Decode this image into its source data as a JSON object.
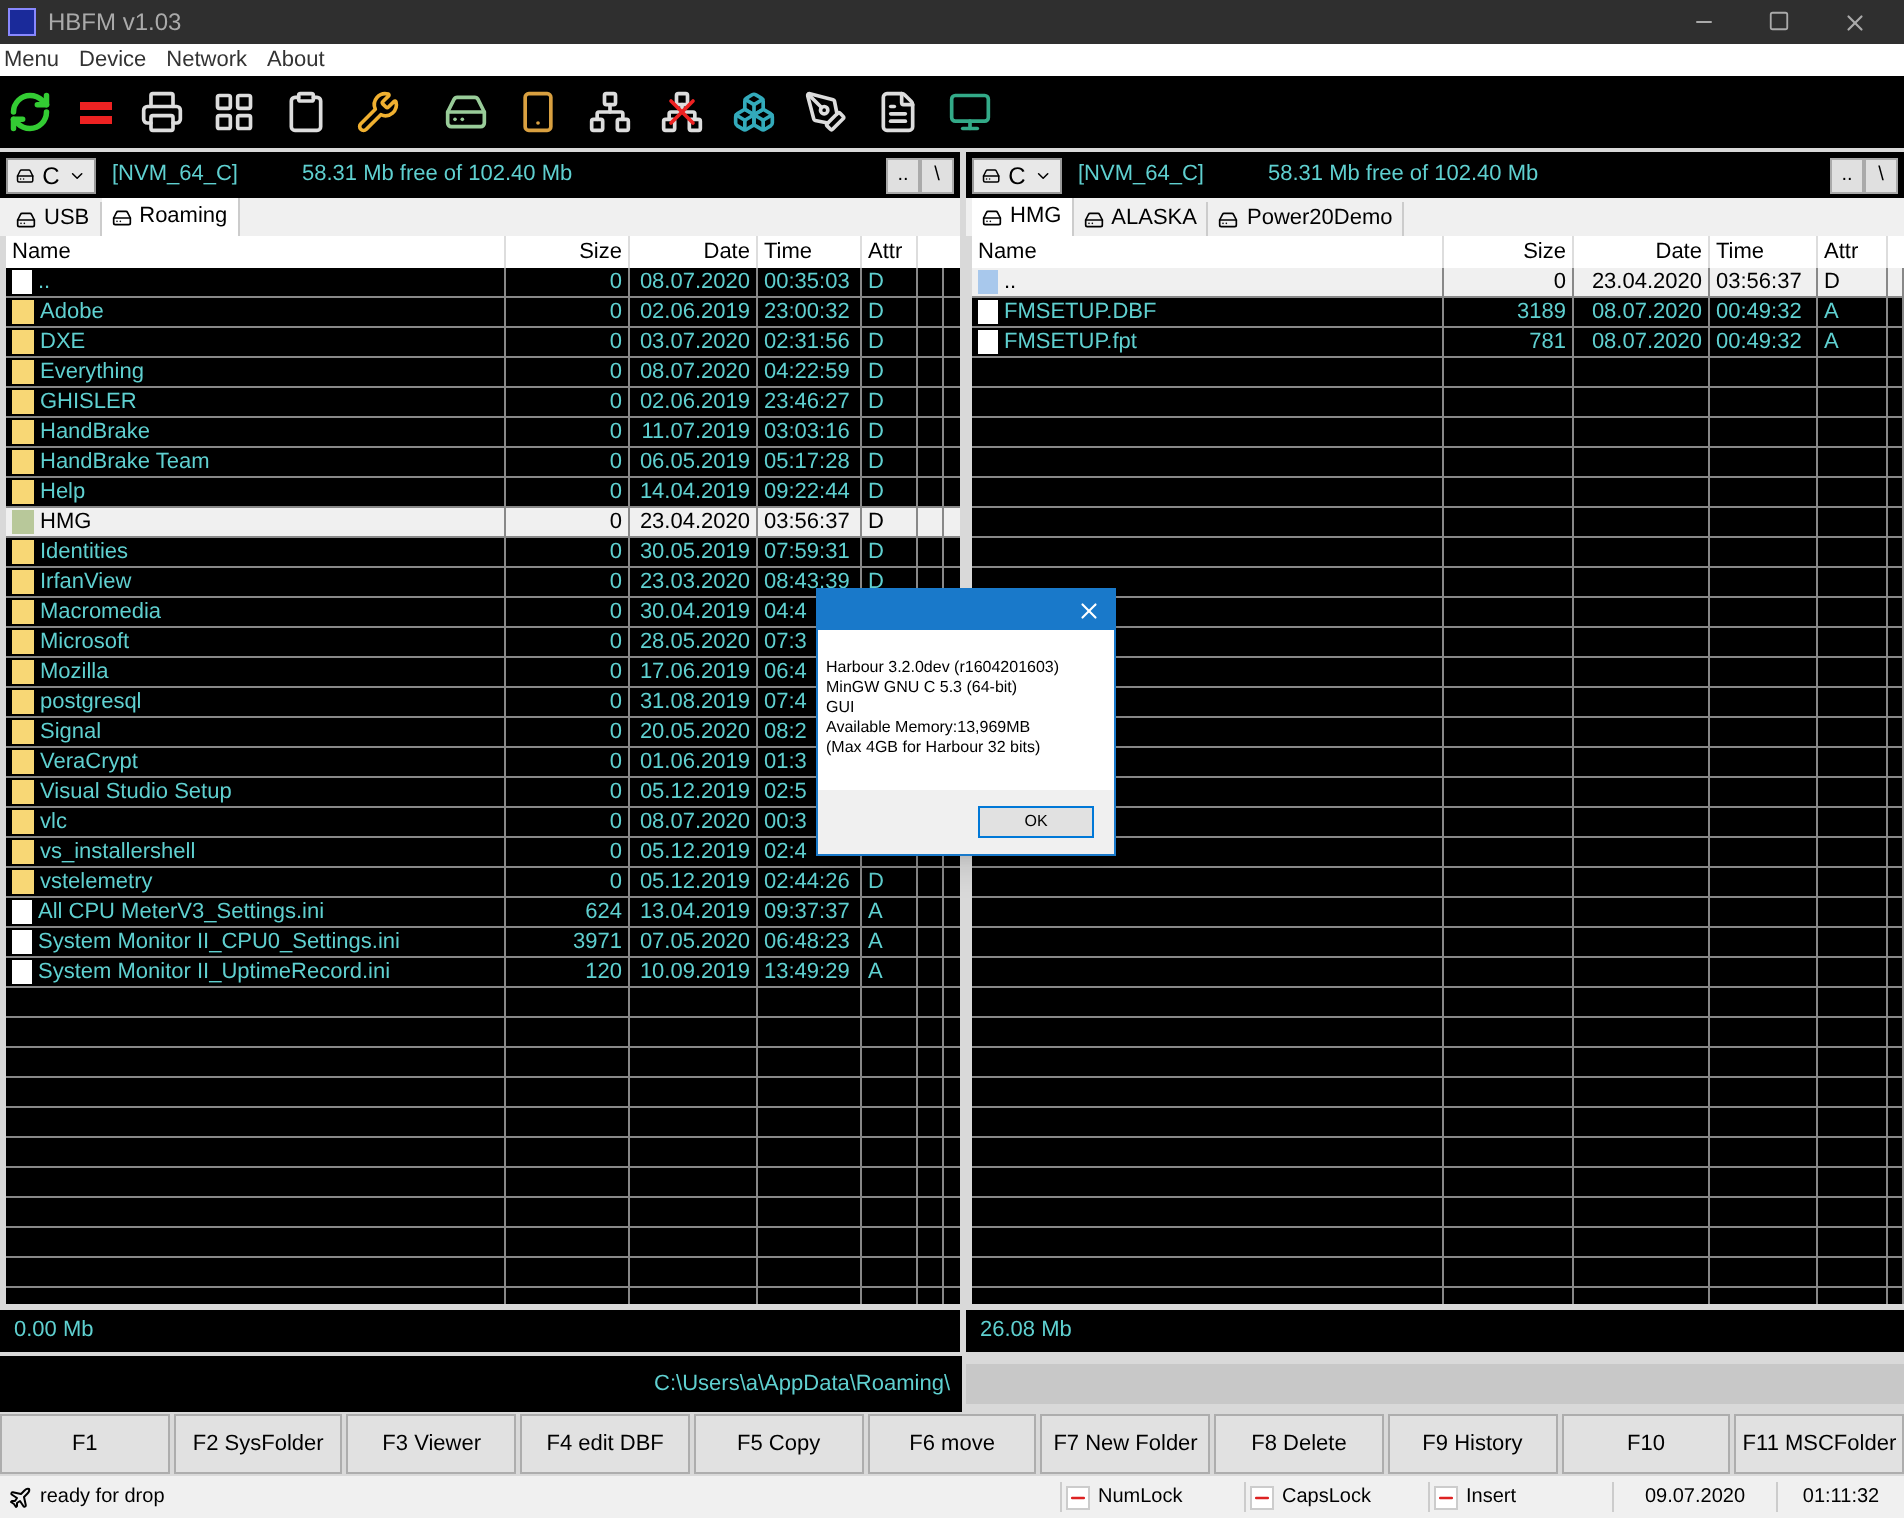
{
  "window": {
    "title": "HBFM v1.03"
  },
  "menu": [
    "Menu",
    "Device",
    "Network",
    "About"
  ],
  "panels": [
    {
      "drive": "C",
      "volume": "[NVM_64_C]",
      "free": "58.31 Mb free of 102.40 Mb",
      "nav_buttons": [
        "..",
        "\\"
      ],
      "tabs": [
        {
          "label": "USB",
          "selected": false
        },
        {
          "label": "Roaming",
          "selected": true
        }
      ],
      "columns": [
        "Name",
        "Size",
        "Date",
        "Time",
        "Attr"
      ],
      "rows": [
        {
          "kind": "parent",
          "name": "..",
          "size": "0",
          "date": "08.07.2020",
          "time": "00:35:03",
          "attr": "D",
          "selected": false
        },
        {
          "kind": "folder",
          "name": "Adobe",
          "size": "0",
          "date": "02.06.2019",
          "time": "23:00:32",
          "attr": "D",
          "selected": false
        },
        {
          "kind": "folder",
          "name": "DXE",
          "size": "0",
          "date": "03.07.2020",
          "time": "02:31:56",
          "attr": "D",
          "selected": false
        },
        {
          "kind": "folder",
          "name": "Everything",
          "size": "0",
          "date": "08.07.2020",
          "time": "04:22:59",
          "attr": "D",
          "selected": false
        },
        {
          "kind": "folder",
          "name": "GHISLER",
          "size": "0",
          "date": "02.06.2019",
          "time": "23:46:27",
          "attr": "D",
          "selected": false
        },
        {
          "kind": "folder",
          "name": "HandBrake",
          "size": "0",
          "date": "11.07.2019",
          "time": "03:03:16",
          "attr": "D",
          "selected": false
        },
        {
          "kind": "folder",
          "name": "HandBrake Team",
          "size": "0",
          "date": "06.05.2019",
          "time": "05:17:28",
          "attr": "D",
          "selected": false
        },
        {
          "kind": "folder",
          "name": "Help",
          "size": "0",
          "date": "14.04.2019",
          "time": "09:22:44",
          "attr": "D",
          "selected": false
        },
        {
          "kind": "folder",
          "name": "HMG",
          "size": "0",
          "date": "23.04.2020",
          "time": "03:56:37",
          "attr": "D",
          "selected": true
        },
        {
          "kind": "folder",
          "name": "Identities",
          "size": "0",
          "date": "30.05.2019",
          "time": "07:59:31",
          "attr": "D",
          "selected": false
        },
        {
          "kind": "folder",
          "name": "IrfanView",
          "size": "0",
          "date": "23.03.2020",
          "time": "08:43:39",
          "attr": "D",
          "selected": false
        },
        {
          "kind": "folder",
          "name": "Macromedia",
          "size": "0",
          "date": "30.04.2019",
          "time": "04:4",
          "selected": false
        },
        {
          "kind": "folder",
          "name": "Microsoft",
          "size": "0",
          "date": "28.05.2020",
          "time": "07:3",
          "selected": false
        },
        {
          "kind": "folder",
          "name": "Mozilla",
          "size": "0",
          "date": "17.06.2019",
          "time": "06:4",
          "selected": false
        },
        {
          "kind": "folder",
          "name": "postgresql",
          "size": "0",
          "date": "31.08.2019",
          "time": "07:4",
          "selected": false
        },
        {
          "kind": "folder",
          "name": "Signal",
          "size": "0",
          "date": "20.05.2020",
          "time": "08:2",
          "selected": false
        },
        {
          "kind": "folder",
          "name": "VeraCrypt",
          "size": "0",
          "date": "01.06.2019",
          "time": "01:3",
          "selected": false
        },
        {
          "kind": "folder",
          "name": "Visual Studio Setup",
          "size": "0",
          "date": "05.12.2019",
          "time": "02:5",
          "selected": false
        },
        {
          "kind": "folder",
          "name": "vlc",
          "size": "0",
          "date": "08.07.2020",
          "time": "00:3",
          "selected": false
        },
        {
          "kind": "folder",
          "name": "vs_installershell",
          "size": "0",
          "date": "05.12.2019",
          "time": "02:4",
          "selected": false
        },
        {
          "kind": "folder",
          "name": "vstelemetry",
          "size": "0",
          "date": "05.12.2019",
          "time": "02:44:26",
          "attr": "D",
          "selected": false
        },
        {
          "kind": "file",
          "name": "All CPU MeterV3_Settings.ini",
          "size": "624",
          "date": "13.04.2019",
          "time": "09:37:37",
          "attr": "A",
          "selected": false
        },
        {
          "kind": "file",
          "name": "System Monitor II_CPU0_Settings.ini",
          "size": "3971",
          "date": "07.05.2020",
          "time": "06:48:23",
          "attr": "A",
          "selected": false
        },
        {
          "kind": "file",
          "name": "System Monitor II_UptimeRecord.ini",
          "size": "120",
          "date": "10.09.2019",
          "time": "13:49:29",
          "attr": "A",
          "selected": false
        }
      ],
      "footer": "0.00 Mb"
    },
    {
      "drive": "C",
      "volume": "[NVM_64_C]",
      "free": "58.31 Mb free of 102.40 Mb",
      "nav_buttons": [
        "..",
        "\\"
      ],
      "tabs": [
        {
          "label": "HMG",
          "selected": true
        },
        {
          "label": "ALASKA",
          "selected": false
        },
        {
          "label": "Power20Demo",
          "selected": false
        }
      ],
      "columns": [
        "Name",
        "Size",
        "Date",
        "Time",
        "Attr"
      ],
      "rows": [
        {
          "kind": "parent",
          "name": "..",
          "size": "0",
          "date": "23.04.2020",
          "time": "03:56:37",
          "attr": "D",
          "selected": true
        },
        {
          "kind": "file",
          "name": "FMSETUP.DBF",
          "size": "3189",
          "date": "08.07.2020",
          "time": "00:49:32",
          "attr": "A",
          "selected": false
        },
        {
          "kind": "file",
          "name": "FMSETUP.fpt",
          "size": "781",
          "date": "08.07.2020",
          "time": "00:49:32",
          "attr": "A",
          "selected": false
        }
      ],
      "footer": "26.08 Mb"
    }
  ],
  "path": "C:\\Users\\a\\AppData\\Roaming\\",
  "function_keys": [
    "F1",
    "F2 SysFolder",
    "F3 Viewer",
    "F4 edit DBF",
    "F5 Copy",
    "F6 move",
    "F7 New Folder",
    "F8 Delete",
    "F9 History",
    "F10",
    "F11 MSCFolder"
  ],
  "status_bar": {
    "message": "ready for drop",
    "indicators": [
      {
        "label": "NumLock",
        "on": false
      },
      {
        "label": "CapsLock",
        "on": false
      },
      {
        "label": "Insert",
        "on": false
      }
    ],
    "date": "09.07.2020",
    "time": "01:11:32"
  },
  "dialog": {
    "lines": [
      "Harbour 3.2.0dev (r1604201603)",
      "MinGW GNU C 5.3 (64-bit)",
      "GUI",
      "Available Memory:13,969MB",
      "(Max 4GB for Harbour 32 bits)"
    ],
    "button": "OK"
  }
}
